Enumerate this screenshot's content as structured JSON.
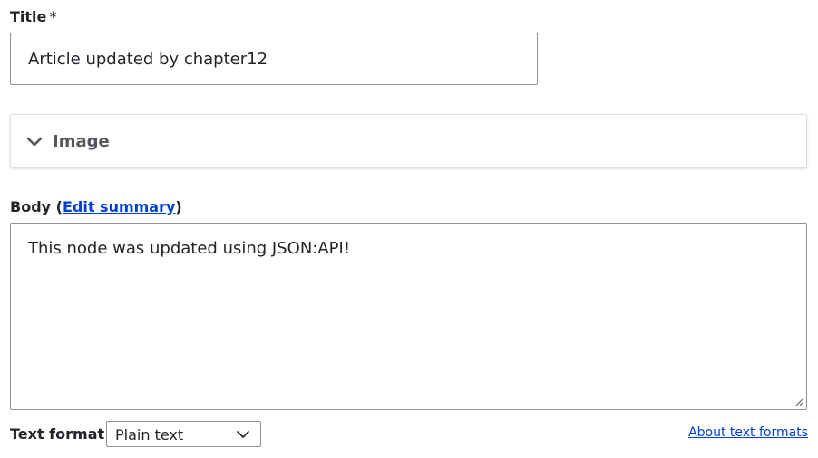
{
  "title_field": {
    "label": "Title",
    "required_mark": "*",
    "value": "Article updated by chapter12"
  },
  "image_section": {
    "label": "Image",
    "icon": "chevron-down-icon",
    "expanded": false
  },
  "body_field": {
    "label_prefix": "Body (",
    "edit_summary_link": "Edit summary",
    "label_suffix": ")",
    "value": "This node was updated using JSON:API!"
  },
  "text_format": {
    "label": "Text format",
    "selected": "Plain text",
    "about_link": "About text formats"
  },
  "colors": {
    "link": "#003ecc",
    "border": "#8e929c",
    "text": "#232429"
  }
}
